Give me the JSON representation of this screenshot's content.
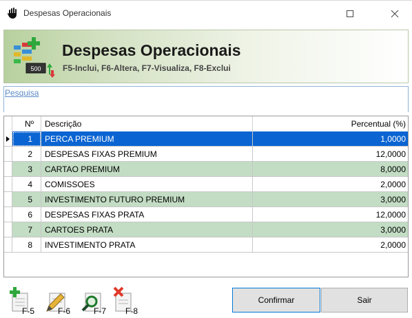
{
  "window": {
    "title": "Despesas Operacionais",
    "app_icon": "hand-icon",
    "controls": [
      "minimize-icon",
      "maximize-icon",
      "close-icon"
    ]
  },
  "banner": {
    "title": "Despesas Operacionais",
    "subtitle": "F5-Inclui, F6-Altera, F7-Visualiza, F8-Exclui",
    "icon_badge": "500"
  },
  "search": {
    "link_label": "Pesquisa"
  },
  "grid": {
    "columns": [
      "Nº",
      "Descrição",
      "Percentual (%)"
    ],
    "rows": [
      {
        "num": "1",
        "desc": "PERCA PREMIUM",
        "perc": "1,0000"
      },
      {
        "num": "2",
        "desc": "DESPESAS FIXAS PREMIUM",
        "perc": "12,0000"
      },
      {
        "num": "3",
        "desc": "CARTAO PREMIUM",
        "perc": "8,0000"
      },
      {
        "num": "4",
        "desc": "COMISSOES",
        "perc": "2,0000"
      },
      {
        "num": "5",
        "desc": "INVESTIMENTO FUTURO PREMIUM",
        "perc": "3,0000"
      },
      {
        "num": "6",
        "desc": "DESPESAS FIXAS PRATA",
        "perc": "12,0000"
      },
      {
        "num": "7",
        "desc": "CARTOES PRATA",
        "perc": "3,0000"
      },
      {
        "num": "8",
        "desc": "INVESTIMENTO PRATA",
        "perc": "2,0000"
      }
    ],
    "selected_row": 0
  },
  "toolbar": {
    "add_label": "F-5",
    "edit_label": "F-6",
    "view_label": "F-7",
    "delete_label": "F-8"
  },
  "buttons": {
    "confirm": "Confirmar",
    "exit": "Sair"
  },
  "colors": {
    "row_alt": "#c3dcc4",
    "selection": "#0a64d2",
    "link": "#5b89c5",
    "focus_border": "#0078d7"
  }
}
